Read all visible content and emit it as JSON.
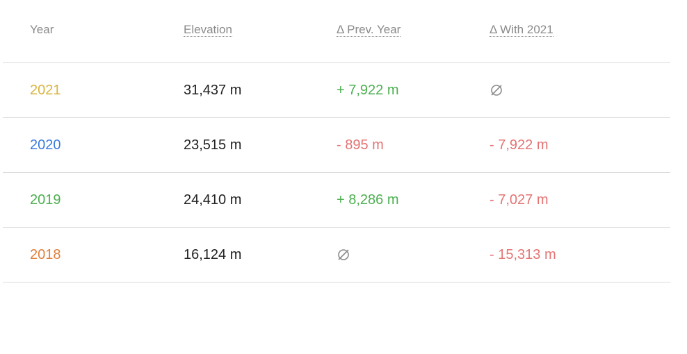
{
  "header": {
    "year": "Year",
    "elevation": "Elevation",
    "delta_prev": "Δ Prev. Year",
    "delta_with": "Δ With 2021"
  },
  "rows": [
    {
      "year": "2021",
      "year_color": "#d9b43a",
      "elevation": "31,437 m",
      "delta_prev": "+ 7,922 m",
      "delta_with": ""
    },
    {
      "year": "2020",
      "year_color": "#3b7be0",
      "elevation": "23,515 m",
      "delta_prev": "- 895 m",
      "delta_with": "- 7,922 m"
    },
    {
      "year": "2019",
      "year_color": "#4caf50",
      "elevation": "24,410 m",
      "delta_prev": "+ 8,286 m",
      "delta_with": "- 7,027 m"
    },
    {
      "year": "2018",
      "year_color": "#e0813b",
      "elevation": "16,124 m",
      "delta_prev": "",
      "delta_with": "- 15,313 m"
    }
  ],
  "colors": {
    "positive": "#4caf50",
    "negative": "#e57373",
    "muted": "#8a8a8a"
  },
  "icons": {
    "empty": "empty-set-icon"
  }
}
